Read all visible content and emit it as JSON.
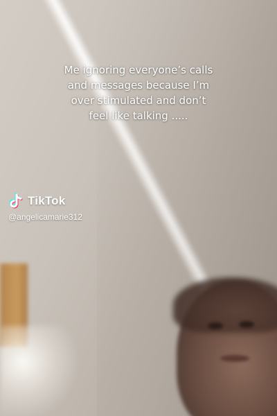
{
  "caption": {
    "text": "Me ignoring everyone’s calls\nand messages because I’m\nover stimulated and don’t\nfeel like talking ....."
  },
  "watermark": {
    "brand": "TikTok",
    "handle": "@angelicamarie312",
    "icon": "tiktok-logo-icon",
    "colors": {
      "cyan": "#25f4ee",
      "red": "#fe2c55",
      "white": "#ffffff"
    }
  }
}
